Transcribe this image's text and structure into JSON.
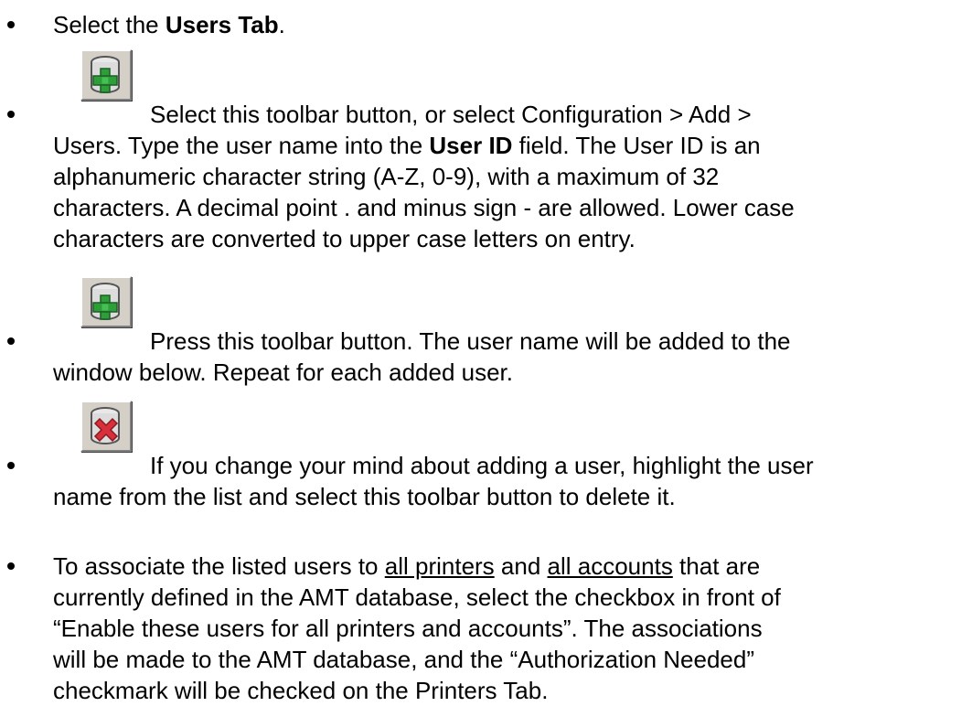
{
  "bullets": [
    {
      "parts": [
        "Select the ",
        "Users Tab",
        "."
      ]
    },
    {
      "icon": "add-user-button-icon",
      "line1": "Select this toolbar button, or select Configuration > Add >",
      "line2_a": "Users. Type the user name into the ",
      "line2_b": "User ID",
      "line2_c": " field. The User ID is an",
      "line3": "alphanumeric character string (A-Z, 0-9), with a maximum of 32",
      "line4": "characters. A decimal point . and minus sign - are allowed. Lower case",
      "line5": "characters are converted to upper case letters on entry."
    },
    {
      "icon": "add-user-button-icon",
      "line1": "Press this toolbar button. The user name will be added to the",
      "line2": "window below. Repeat for each added user."
    },
    {
      "icon": "delete-user-button-icon",
      "line1": "If you change your mind about adding a user, highlight the user",
      "line2": "name from the list and select this toolbar button to delete it."
    },
    {
      "line1_a": "To associate the listed users to ",
      "line1_b": "all printers",
      "line1_c": " and ",
      "line1_d": "all accounts",
      "line1_e": " that are",
      "line2": "currently defined in the AMT database, select the checkbox in front of",
      "line3": "“Enable these users for all printers and accounts”. The associations",
      "line4": "will be made to the AMT database, and the “Authorization Needed”",
      "line5": "checkmark will be checked on the Printers Tab."
    }
  ],
  "colors": {
    "button_face": "#d4d0c8",
    "add_green": "#2e9e3a",
    "delete_red": "#d8303a"
  }
}
